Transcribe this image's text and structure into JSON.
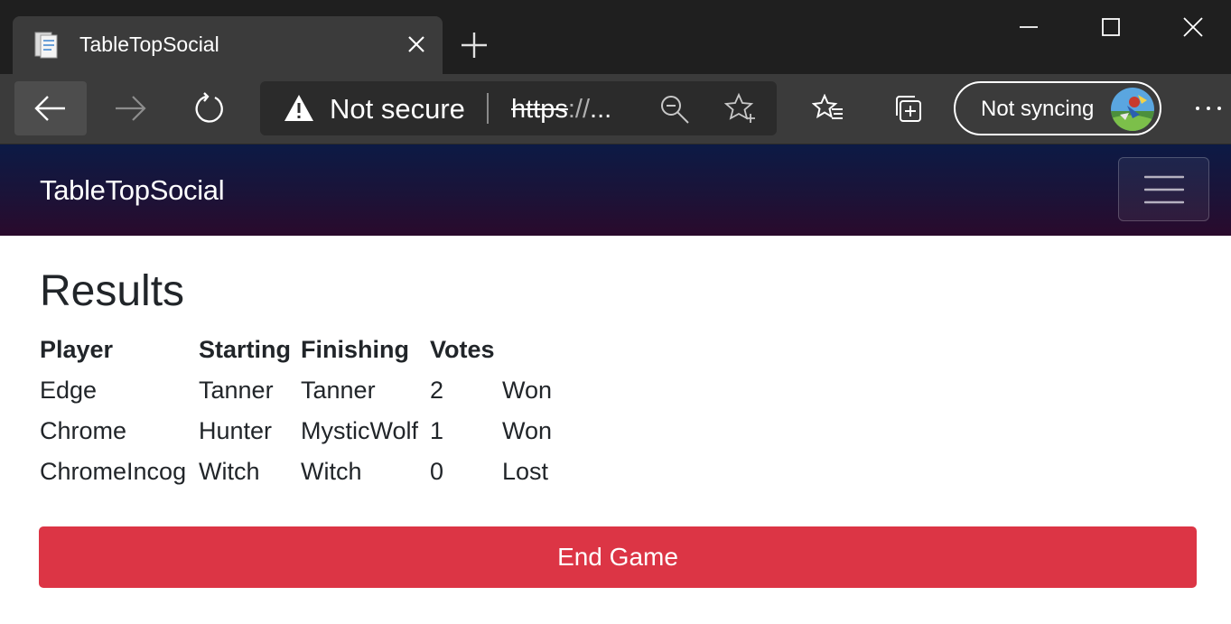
{
  "browser": {
    "tab": {
      "title": "TableTopSocial",
      "favicon": "page-document-icon"
    },
    "window_controls": [
      "minimize-icon",
      "maximize-icon",
      "close-icon"
    ],
    "toolbar": {
      "security_label": "Not secure",
      "url_scheme": "https",
      "url_rest": "://",
      "url_ellipsis": "...",
      "sync_label": "Not syncing",
      "icons": [
        "back-arrow-icon",
        "forward-arrow-icon",
        "refresh-icon",
        "warning-icon",
        "zoom-out-icon",
        "add-favorite-icon",
        "favorites-icon",
        "collections-icon",
        "more-icon"
      ]
    }
  },
  "navbar": {
    "brand": "TableTopSocial",
    "toggler_icon": "hamburger-menu-icon",
    "gradient": [
      "#0c1a45",
      "#2a0a2c"
    ]
  },
  "main": {
    "title": "Results",
    "table": {
      "headers": [
        "Player",
        "Starting",
        "Finishing",
        "Votes",
        ""
      ],
      "rows": [
        [
          "Edge",
          "Tanner",
          "Tanner",
          "2",
          "Won"
        ],
        [
          "Chrome",
          "Hunter",
          "MysticWolf",
          "1",
          "Won"
        ],
        [
          "ChromeIncog",
          "Witch",
          "Witch",
          "0",
          "Lost"
        ]
      ]
    },
    "end_game_button": {
      "label": "End Game",
      "color": "#dc3545"
    }
  }
}
